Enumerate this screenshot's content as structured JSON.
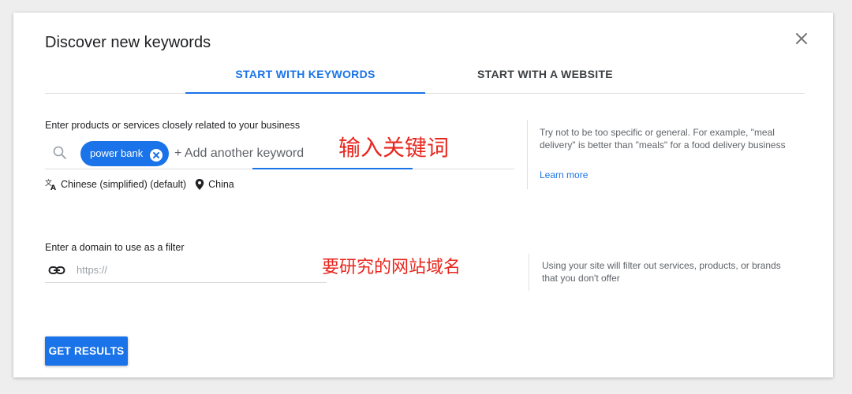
{
  "dialog": {
    "title": "Discover new keywords",
    "close_icon": "close-icon"
  },
  "tabs": [
    {
      "label": "START WITH KEYWORDS",
      "active": true
    },
    {
      "label": "START WITH A WEBSITE",
      "active": false
    }
  ],
  "keywords": {
    "label": "Enter products or services closely related to your business",
    "chips": [
      {
        "label": "power bank"
      }
    ],
    "add_placeholder": "+ Add another keyword",
    "annotation": "输入关键词",
    "language": "Chinese (simplified) (default)",
    "location": "China",
    "help_text": "Try not to be too specific or general. For example, \"meal delivery\" is better than \"meals\" for a food delivery business",
    "learn_more": "Learn more"
  },
  "domain": {
    "label": "Enter a domain to use as a filter",
    "placeholder": "https://",
    "annotation": "要研究的网站域名",
    "help_text": "Using your site will filter out services, products, or brands that you don't offer"
  },
  "actions": {
    "get_results": "GET RESULTS"
  },
  "colors": {
    "accent": "#1a73e8",
    "annotation": "#e8261e"
  }
}
